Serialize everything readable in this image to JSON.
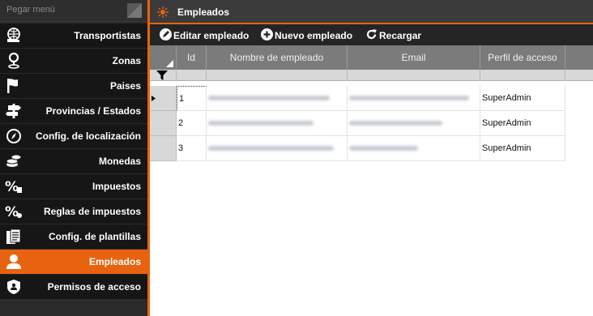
{
  "sidebar": {
    "pin_label": "Pegar menú",
    "items": [
      {
        "label": "Transportistas",
        "icon": "globe-truck-icon"
      },
      {
        "label": "Zonas",
        "icon": "location-pin-icon"
      },
      {
        "label": "Paises",
        "icon": "flag-icon"
      },
      {
        "label": "Provincias / Estados",
        "icon": "signpost-icon"
      },
      {
        "label": "Config. de localización",
        "icon": "compass-icon"
      },
      {
        "label": "Monedas",
        "icon": "coins-icon"
      },
      {
        "label": "Impuestos",
        "icon": "percent-icon"
      },
      {
        "label": "Reglas de impuestos",
        "icon": "percent-gear-icon"
      },
      {
        "label": "Config. de plantillas",
        "icon": "document-icon"
      },
      {
        "label": "Empleados",
        "icon": "user-icon",
        "active": true
      },
      {
        "label": "Permisos de acceso",
        "icon": "shield-icon"
      }
    ]
  },
  "title": "Empleados",
  "toolbar": {
    "edit_label": "Editar empleado",
    "new_label": "Nuevo empleado",
    "reload_label": "Recargar"
  },
  "grid": {
    "columns": [
      "Id",
      "Nombre de empleado",
      "Email",
      "Perfil de acceso"
    ],
    "rows": [
      {
        "id": "1",
        "profile": "SuperAdmin"
      },
      {
        "id": "2",
        "profile": "SuperAdmin"
      },
      {
        "id": "3",
        "profile": "SuperAdmin"
      }
    ]
  },
  "colors": {
    "accent": "#e8630f",
    "sidebar_bg": "#161616",
    "header_bg": "#7b7b7b"
  }
}
